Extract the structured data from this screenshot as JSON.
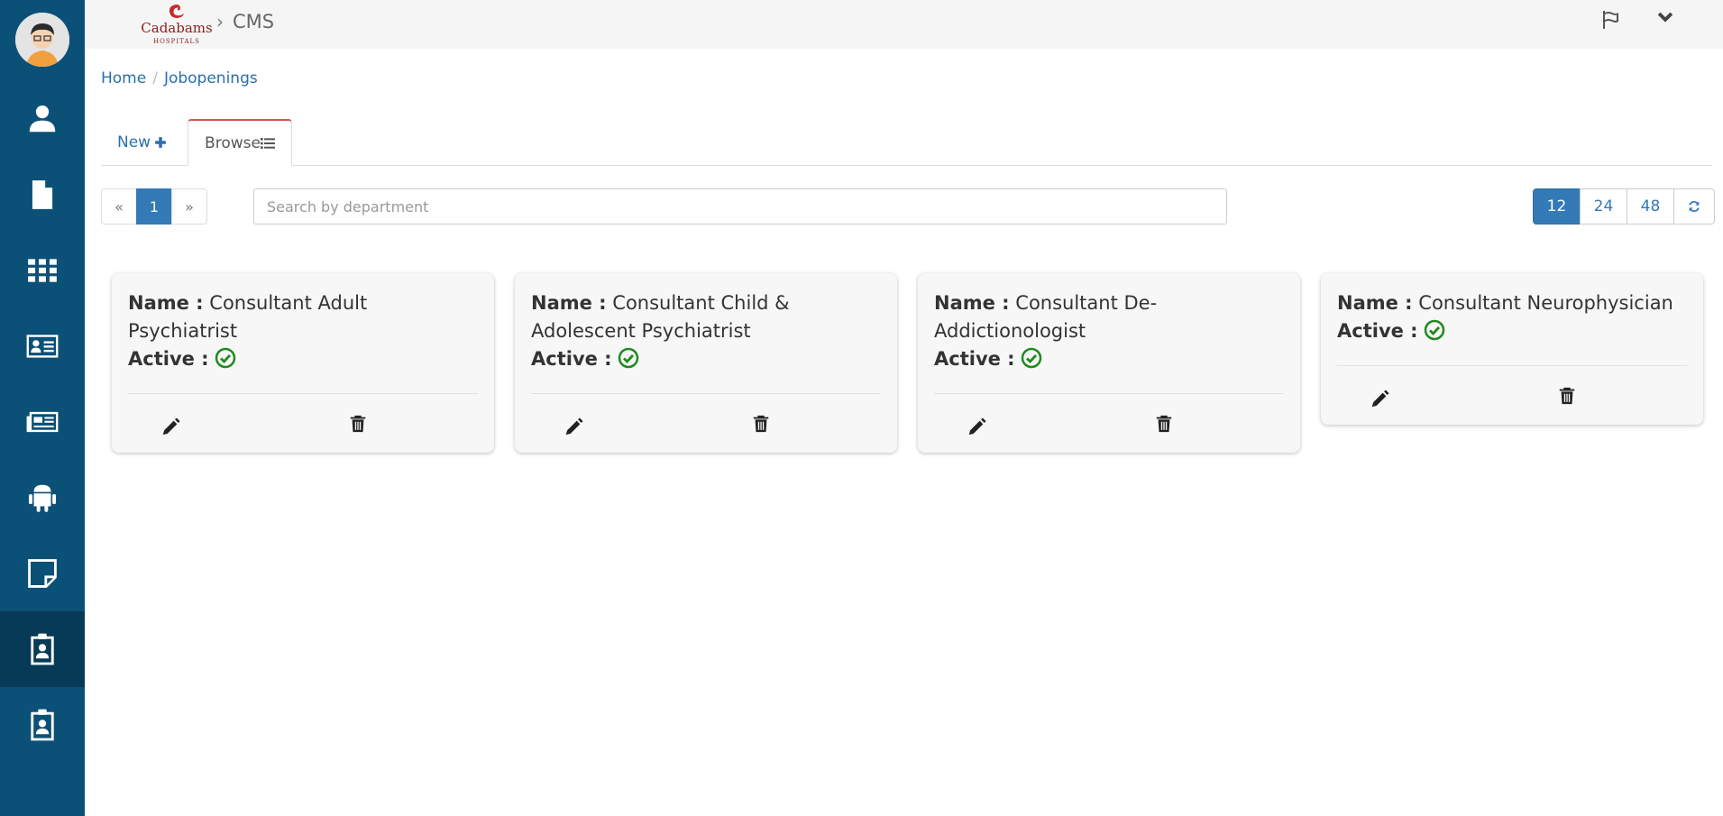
{
  "topbar": {
    "brand_title": "CMS",
    "separator": "›"
  },
  "breadcrumb": {
    "home": "Home",
    "separator": "/",
    "current": "Jobopenings"
  },
  "tabs": {
    "new_label": "New",
    "new_icon": "plus-icon",
    "browse_label": "Browse",
    "browse_icon": "list-icon"
  },
  "pager": {
    "prev": "«",
    "current": "1",
    "next": "»"
  },
  "search": {
    "placeholder": "Search by department",
    "value": ""
  },
  "page_sizes": [
    "12",
    "24",
    "48"
  ],
  "colors": {
    "sidebar": "#0b5077",
    "accent": "#337ab7",
    "active_tab_border": "#d9534f",
    "check": "#1f8a1f"
  },
  "cards": [
    {
      "name_label": "Name :",
      "name": "Consultant Adult Psychiatrist",
      "active_label": "Active :",
      "active": true
    },
    {
      "name_label": "Name :",
      "name": "Consultant Child & Adolescent Psychiatrist",
      "active_label": "Active :",
      "active": true
    },
    {
      "name_label": "Name :",
      "name": "Consultant De-Addictionologist",
      "active_label": "Active :",
      "active": true
    },
    {
      "name_label": "Name :",
      "name": "Consultant Neurophysician",
      "active_label": "Active :",
      "active": true
    }
  ]
}
